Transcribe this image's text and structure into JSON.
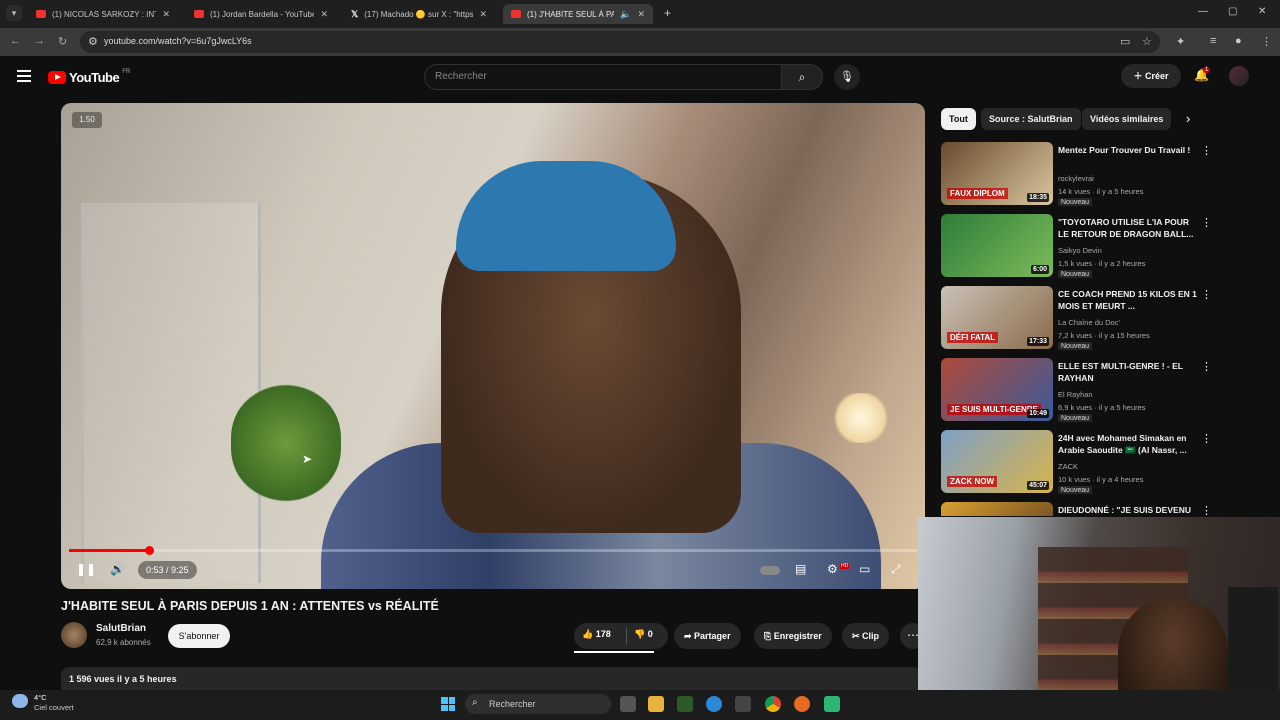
{
  "browser": {
    "tabs": [
      {
        "label": "(1) NICOLAS SARKOZY : INTERV",
        "favicon": "youtube-icon"
      },
      {
        "label": "(1) Jordan Bardella - YouTube",
        "favicon": "youtube-icon"
      },
      {
        "label": "(17) Machado 🟡 sur X : \"https:",
        "favicon": "x-icon"
      },
      {
        "label": "(1) J'HABITE SEUL À PARIS D",
        "favicon": "youtube-icon",
        "active": true
      }
    ],
    "url": "youtube.com/watch?v=6u7gJwcLY6s"
  },
  "yt": {
    "logo": "YouTube",
    "region": "FR",
    "search_placeholder": "Rechercher",
    "create_label": "Créer",
    "notif_count": "1"
  },
  "player": {
    "speed": "1.50",
    "time": "0:53 / 9:25",
    "progress": 0.094
  },
  "video": {
    "title": "J'HABITE SEUL À PARIS DEPUIS 1 AN : ATTENTES vs RÉALITÉ",
    "channel": "SalutBrian",
    "subscribers": "62,9 k abonnés",
    "subscribe_label": "S'abonner",
    "likes": "178",
    "dislikes": "0",
    "share_label": "Partager",
    "save_label": "Enregistrer",
    "clip_label": "Clip",
    "stats": "1 596 vues  il y a 5 heures"
  },
  "sidebar": {
    "chips": [
      "Tout",
      "Source : SalutBrian",
      "Vidéos similaires"
    ],
    "items": [
      {
        "title": "Mentez Pour Trouver Du Travail !",
        "channel": "rockylevrai",
        "meta": "14 k vues · il y a 5 heures",
        "badge": "Nouveau",
        "duration": "18:35",
        "thumb_text": "FAUX DIPLOM",
        "colors": [
          "#6a4a2e",
          "#d9c79e"
        ]
      },
      {
        "title": "\"TOYOTARO UTILISE L'IA POUR LE RETOUR DE DRAGON BALL...",
        "channel": "Saikyo Devin",
        "meta": "1,5 k vues · il y a 2 heures",
        "badge": "Nouveau",
        "duration": "6:00",
        "thumb_text": "",
        "colors": [
          "#2e7d3a",
          "#7dbb5a"
        ]
      },
      {
        "title": "CE COACH PREND 15 KILOS EN 1 MOIS ET MEURT ...",
        "channel": "La Chaîne du Doc'",
        "meta": "7,2 k vues · il y a 15 heures",
        "badge": "Nouveau",
        "duration": "17:33",
        "thumb_text": "DÉFI FATAL",
        "colors": [
          "#c9c2b6",
          "#8a6a4a"
        ]
      },
      {
        "title": "ELLE EST MULTI-GENRE ! - EL RAYHAN",
        "channel": "El Rayhan",
        "meta": "6,9 k vues · il y a 5 heures",
        "badge": "Nouveau",
        "duration": "10:49",
        "thumb_text": "JE SUIS MULTI-GENRE",
        "colors": [
          "#b04a3a",
          "#3a5a9a"
        ]
      },
      {
        "title": "24H avec Mohamed Simakan en Arabie Saoudite 🇸🇦 (Al Nassr, ...",
        "channel": "ZACK",
        "meta": "10 k vues · il y a 4 heures",
        "badge": "Nouveau",
        "duration": "45:07",
        "thumb_text": "ZACK NOW",
        "colors": [
          "#7ea0c8",
          "#d8b448"
        ]
      },
      {
        "title": "DIEUDONNÉ : \"JE SUIS DEVENU",
        "channel": "",
        "meta": "",
        "badge": "",
        "duration": "",
        "thumb_text": "",
        "colors": [
          "#d8a030",
          "#5a3a20"
        ]
      }
    ]
  },
  "taskbar": {
    "temperature": "4°C",
    "weather": "Ciel couvert",
    "search_label": "Rechercher"
  }
}
